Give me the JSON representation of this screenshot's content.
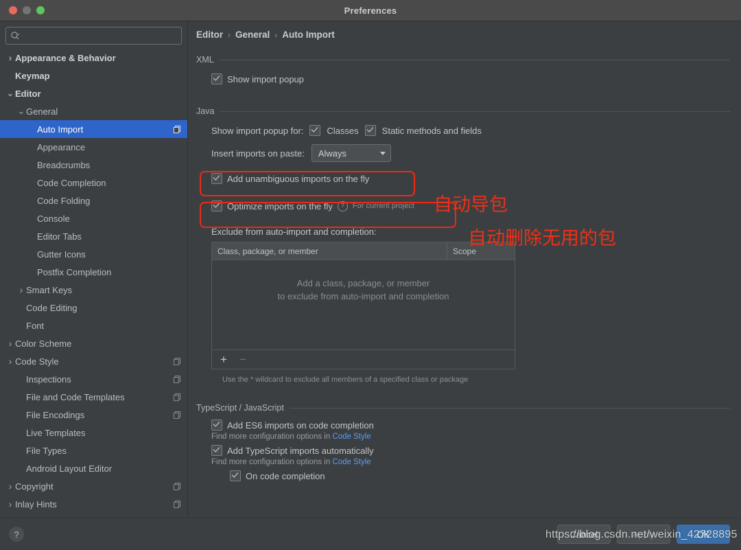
{
  "window": {
    "title": "Preferences",
    "traffic_lights": [
      "close",
      "minimize",
      "maximize"
    ]
  },
  "sidebar": {
    "search": {
      "value": "",
      "placeholder": ""
    },
    "items": [
      {
        "label": "Appearance & Behavior",
        "indent": 0,
        "arrow": "collapsed",
        "bold": true,
        "selected": false,
        "copy": false
      },
      {
        "label": "Keymap",
        "indent": 0,
        "arrow": "none",
        "bold": true,
        "selected": false,
        "copy": false
      },
      {
        "label": "Editor",
        "indent": 0,
        "arrow": "expanded",
        "bold": true,
        "selected": false,
        "copy": false
      },
      {
        "label": "General",
        "indent": 1,
        "arrow": "expanded",
        "bold": false,
        "selected": false,
        "copy": false
      },
      {
        "label": "Auto Import",
        "indent": 2,
        "arrow": "none",
        "bold": false,
        "selected": true,
        "copy": true
      },
      {
        "label": "Appearance",
        "indent": 2,
        "arrow": "none",
        "bold": false,
        "selected": false,
        "copy": false
      },
      {
        "label": "Breadcrumbs",
        "indent": 2,
        "arrow": "none",
        "bold": false,
        "selected": false,
        "copy": false
      },
      {
        "label": "Code Completion",
        "indent": 2,
        "arrow": "none",
        "bold": false,
        "selected": false,
        "copy": false
      },
      {
        "label": "Code Folding",
        "indent": 2,
        "arrow": "none",
        "bold": false,
        "selected": false,
        "copy": false
      },
      {
        "label": "Console",
        "indent": 2,
        "arrow": "none",
        "bold": false,
        "selected": false,
        "copy": false
      },
      {
        "label": "Editor Tabs",
        "indent": 2,
        "arrow": "none",
        "bold": false,
        "selected": false,
        "copy": false
      },
      {
        "label": "Gutter Icons",
        "indent": 2,
        "arrow": "none",
        "bold": false,
        "selected": false,
        "copy": false
      },
      {
        "label": "Postfix Completion",
        "indent": 2,
        "arrow": "none",
        "bold": false,
        "selected": false,
        "copy": false
      },
      {
        "label": "Smart Keys",
        "indent": 1,
        "arrow": "collapsed",
        "bold": false,
        "selected": false,
        "copy": false
      },
      {
        "label": "Code Editing",
        "indent": 1,
        "arrow": "none",
        "bold": false,
        "selected": false,
        "copy": false
      },
      {
        "label": "Font",
        "indent": 1,
        "arrow": "none",
        "bold": false,
        "selected": false,
        "copy": false
      },
      {
        "label": "Color Scheme",
        "indent": 0,
        "arrow": "collapsed",
        "bold": false,
        "selected": false,
        "copy": false
      },
      {
        "label": "Code Style",
        "indent": 0,
        "arrow": "collapsed",
        "bold": false,
        "selected": false,
        "copy": true
      },
      {
        "label": "Inspections",
        "indent": 1,
        "arrow": "none",
        "bold": false,
        "selected": false,
        "copy": true
      },
      {
        "label": "File and Code Templates",
        "indent": 1,
        "arrow": "none",
        "bold": false,
        "selected": false,
        "copy": true
      },
      {
        "label": "File Encodings",
        "indent": 1,
        "arrow": "none",
        "bold": false,
        "selected": false,
        "copy": true
      },
      {
        "label": "Live Templates",
        "indent": 1,
        "arrow": "none",
        "bold": false,
        "selected": false,
        "copy": false
      },
      {
        "label": "File Types",
        "indent": 1,
        "arrow": "none",
        "bold": false,
        "selected": false,
        "copy": false
      },
      {
        "label": "Android Layout Editor",
        "indent": 1,
        "arrow": "none",
        "bold": false,
        "selected": false,
        "copy": false
      },
      {
        "label": "Copyright",
        "indent": 0,
        "arrow": "collapsed",
        "bold": false,
        "selected": false,
        "copy": true
      },
      {
        "label": "Inlay Hints",
        "indent": 0,
        "arrow": "collapsed",
        "bold": false,
        "selected": false,
        "copy": true
      }
    ]
  },
  "breadcrumb": {
    "part1": "Editor",
    "sep1": "›",
    "part2": "General",
    "sep2": "›",
    "part3": "Auto Import"
  },
  "xml_section": {
    "title": "XML",
    "show_import_popup": {
      "label": "Show import popup",
      "checked": true
    }
  },
  "java_section": {
    "title": "Java",
    "show_import_popup_for_label": "Show import popup for:",
    "classes": {
      "label": "Classes",
      "checked": true
    },
    "static_methods": {
      "label": "Static methods and fields",
      "checked": true
    },
    "insert_imports_label": "Insert imports on paste:",
    "insert_imports_value": "Always",
    "add_unambiguous": {
      "label": "Add unambiguous imports on the fly",
      "checked": true
    },
    "optimize_imports": {
      "label": "Optimize imports on the fly",
      "checked": true,
      "help_icon": "?",
      "scope_note": "For current project"
    },
    "exclude_label": "Exclude from auto-import and completion:",
    "table": {
      "columns": [
        "Class, package, or member",
        "Scope"
      ],
      "rows": [],
      "empty_line1": "Add a class, package, or member",
      "empty_line2": "to exclude from auto-import and completion",
      "add_button": "+",
      "remove_button": "−"
    },
    "wildcard_hint": "Use the * wildcard to exclude all members of a specified class or package"
  },
  "ts_section": {
    "title": "TypeScript / JavaScript",
    "es6": {
      "label": "Add ES6 imports on code completion",
      "checked": true
    },
    "es6_hint_pre": "Find more configuration options in ",
    "es6_hint_link": "Code Style",
    "ts_auto": {
      "label": "Add TypeScript imports automatically",
      "checked": true
    },
    "ts_hint_pre": "Find more configuration options in ",
    "ts_hint_link": "Code Style",
    "on_code_completion": {
      "label": "On code completion",
      "checked": true
    }
  },
  "annotations": [
    {
      "text": "自动导包",
      "color": "#ee3018"
    },
    {
      "text": "自动删除无用的包",
      "color": "#ee3018"
    }
  ],
  "footer": {
    "help": "?",
    "cancel": "Cancel",
    "apply": "Apply",
    "ok": "OK"
  },
  "watermark": "https://blog.csdn.net/weixin_42728895",
  "colors": {
    "window_bg": "#3c3f41",
    "titlebar_bg": "#4a4a4a",
    "selection_blue": "#2f65ca",
    "primary_button": "#3a6ea8",
    "annotation_red": "#ed2a15",
    "link_blue": "#589df6"
  }
}
